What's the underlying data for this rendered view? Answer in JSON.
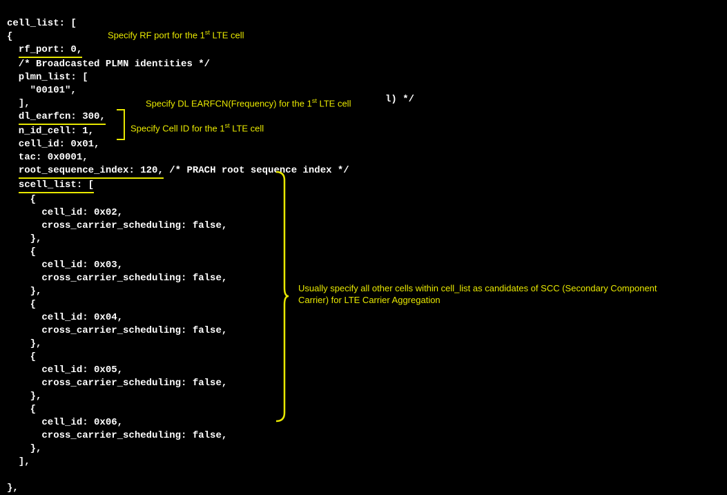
{
  "code": {
    "l1": "cell_list: [",
    "l2": "{",
    "l3_indent": "  ",
    "l3_ul": "rf_port: 0,",
    "l4": "  /* Broadcasted PLMN identities */",
    "l5": "  plmn_list: [",
    "l6": "    \"00101\",",
    "l7": "  ],",
    "l8_indent": "  ",
    "l8_ul": "dl_earfcn: 300,",
    "l9": "  n_id_cell: 1,",
    "l10": "  cell_id: 0x01,",
    "l11": "  tac: 0x0001,",
    "l12_indent": "  ",
    "l12_ul": "root_sequence_index: 120,",
    "l12_rest": " /* PRACH root sequence index */",
    "l13_indent": "  ",
    "l13_ul": "scell_list: [",
    "l14": "    {",
    "l15": "      cell_id: 0x02,",
    "l16": "      cross_carrier_scheduling: false,",
    "l17": "    },",
    "l18": "    {",
    "l19": "      cell_id: 0x03,",
    "l20": "      cross_carrier_scheduling: false,",
    "l21": "    },",
    "l22": "    {",
    "l23": "      cell_id: 0x04,",
    "l24": "      cross_carrier_scheduling: false,",
    "l25": "    },",
    "l26": "    {",
    "l27": "      cell_id: 0x05,",
    "l28": "      cross_carrier_scheduling: false,",
    "l29": "    },",
    "l30": "    {",
    "l31": "      cell_id: 0x06,",
    "l32": "      cross_carrier_scheduling: false,",
    "l33": "    },",
    "l34": "  ],",
    "l35": "",
    "l36": "},"
  },
  "annotations": {
    "rf_port_pre": "Specify RF port for the 1",
    "rf_port_sup": "st",
    "rf_port_post": " LTE cell",
    "earfcn_pre": "Specify DL EARFCN(Frequency) for the 1",
    "earfcn_sup": "st",
    "earfcn_post": " LTE cell",
    "earfcn_tail": "l) */",
    "cellid_pre": "Specify Cell ID for the 1",
    "cellid_sup": "st",
    "cellid_post": " LTE cell",
    "scell": "Usually specify all other cells within cell_list as candidates of SCC (Secondary Component Carrier) for LTE Carrier Aggregation"
  }
}
